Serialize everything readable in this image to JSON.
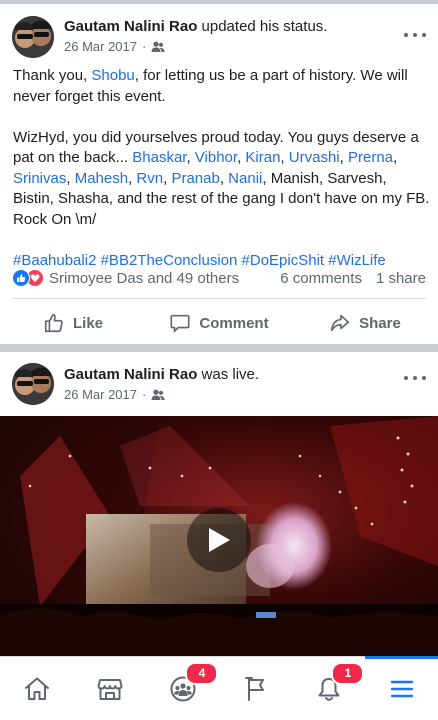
{
  "posts": [
    {
      "author": "Gautam Nalini Rao",
      "action": "updated his status.",
      "date": "26 Mar 2017",
      "privacy_icon": "friends-icon",
      "text": {
        "p1_a": "Thank you, ",
        "p1_link": "Shobu",
        "p1_b": ", for letting us be a part of history. We will never forget this event.",
        "p2_a": "WizHyd, you did yourselves proud today.  You guys deserve a pat on the back... ",
        "mentions": [
          "Bhaskar",
          "Vibhor",
          "Kiran",
          "Urvashi",
          "Prerna",
          "Srinivas",
          "Mahesh",
          "Rvn",
          "Pranab",
          "Nanii"
        ],
        "p2_b": "Manish, Sarvesh, Bistin, Shasha, and the rest of the gang I don't have on my FB. Rock On \\m/",
        "hashtags": [
          "#Baahubali2",
          "#BB2TheConclusion",
          "#DoEpicShit",
          "#WizLife"
        ]
      },
      "reactions_text": "Srimoyee Das and 49 others",
      "comments_text": "6 comments",
      "shares_text": "1 share",
      "actions": {
        "like": "Like",
        "comment": "Comment",
        "share": "Share"
      }
    },
    {
      "author": "Gautam Nalini Rao",
      "action": "was live.",
      "date": "26 Mar 2017",
      "privacy_icon": "friends-icon"
    }
  ],
  "bottom_nav": {
    "items": [
      "home-icon",
      "marketplace-icon",
      "groups-icon",
      "pages-flag-icon",
      "notifications-bell-icon",
      "menu-icon"
    ],
    "groups_badge": "4",
    "notifications_badge": "1",
    "active": "menu-icon"
  },
  "colors": {
    "link": "#216fdb",
    "accent": "#1877f2",
    "badge": "#f02849",
    "love": "#f33e58"
  }
}
